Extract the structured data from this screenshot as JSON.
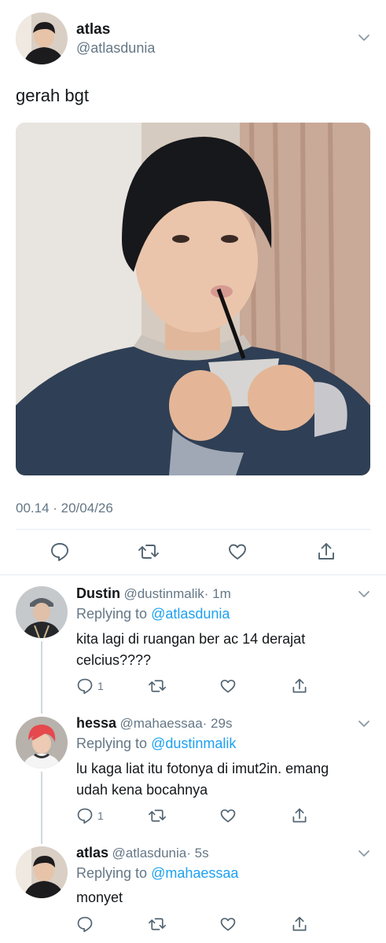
{
  "main_tweet": {
    "display_name": "atlas",
    "handle": "@atlasdunia",
    "text": "gerah bgt",
    "timestamp": "00.14 · 20/04/26"
  },
  "replies": [
    {
      "display_name": "Dustin",
      "handle": "@dustinmalik",
      "time": "· 1m",
      "replying_label": "Replying to",
      "replying_to": "@atlasdunia",
      "text_line1": "kita lagi di ruangan ber ac 14 derajat",
      "text_line2": "celcius????",
      "reply_count": "1"
    },
    {
      "display_name": "hessa",
      "handle": "@mahaessaa",
      "time": "· 29s",
      "replying_label": "Replying to",
      "replying_to": "@dustinmalik",
      "text_line1": "lu kaga liat itu fotonya di imut2in. emang",
      "text_line2": "udah kena bocahnya",
      "reply_count": "1"
    },
    {
      "display_name": "atlas",
      "handle": "@atlasdunia",
      "time": "· 5s",
      "replying_label": "Replying to",
      "replying_to": "@mahaessaa",
      "text_line1": "monyet",
      "text_line2": "",
      "reply_count": ""
    }
  ],
  "icons": {
    "reply": "reply-icon",
    "retweet": "retweet-icon",
    "like": "heart-icon",
    "share": "share-icon",
    "menu": "chevron-down-icon"
  },
  "colors": {
    "link": "#1da1f2",
    "muted": "#657786",
    "text": "#14171a",
    "divider": "#e6ecf0"
  }
}
